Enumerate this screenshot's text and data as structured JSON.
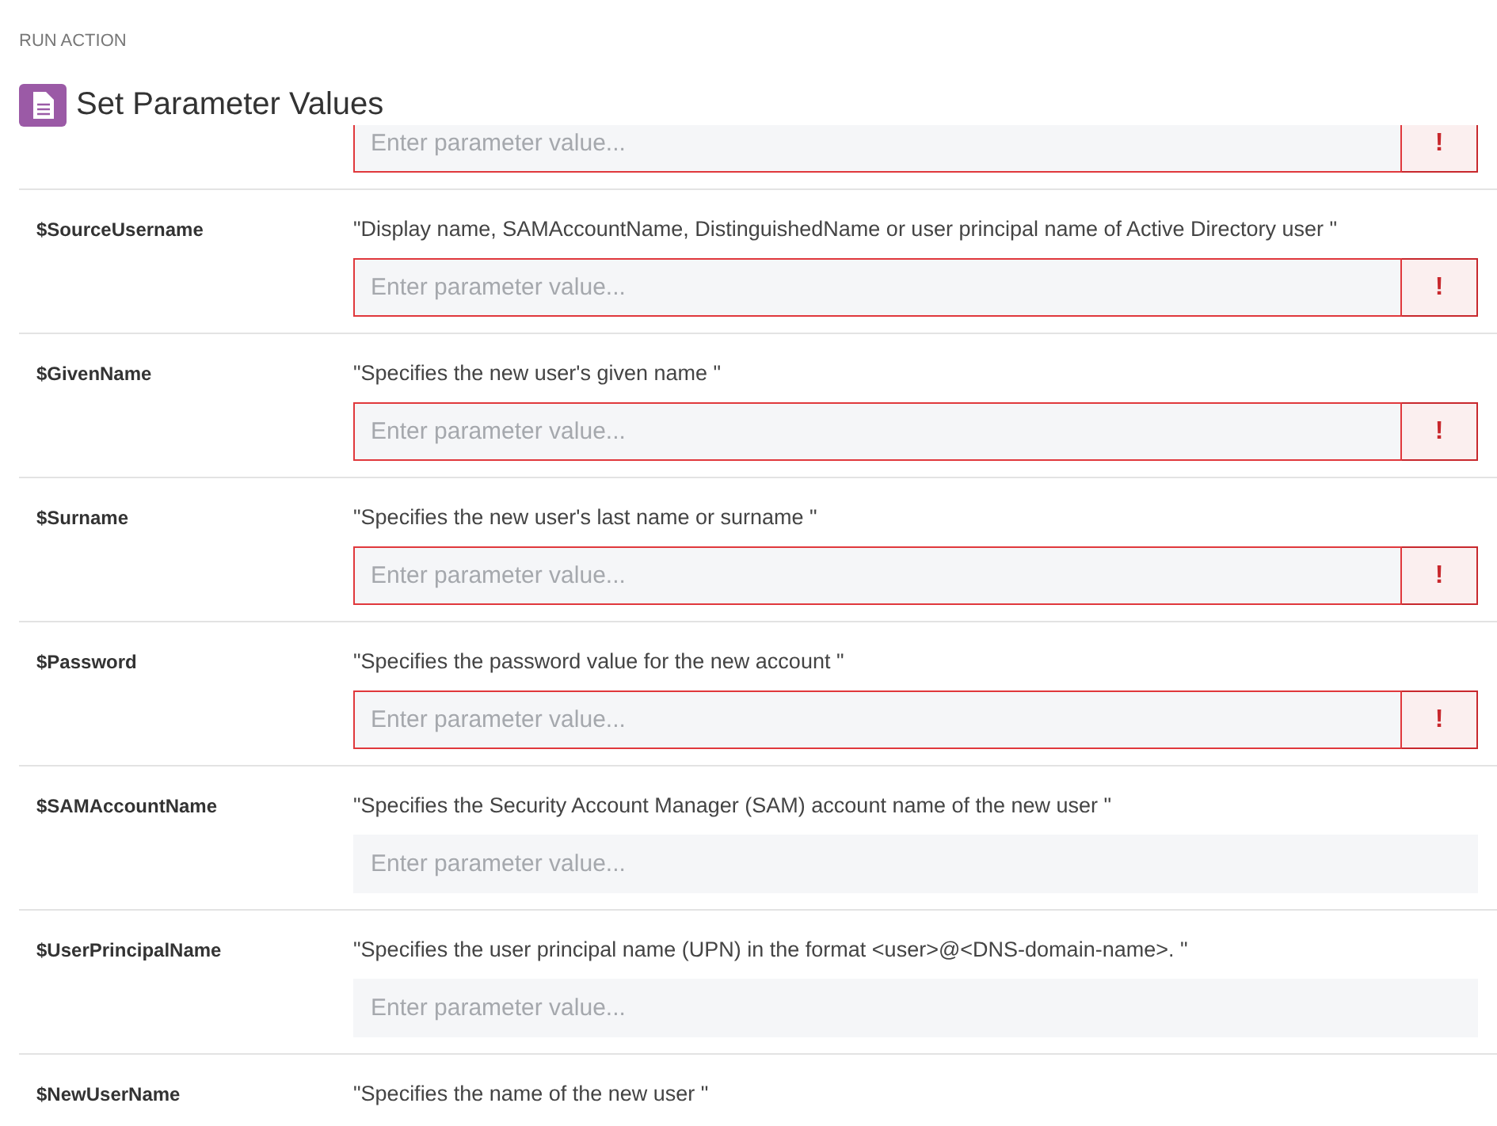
{
  "header": {
    "section": "RUN ACTION",
    "title": "Set Parameter Values"
  },
  "parameters": [
    {
      "field": {
        "placeholder": "Enter parameter value...",
        "required": true,
        "alert": "!"
      }
    },
    {
      "name": "$SourceUsername",
      "description": "\"Display name, SAMAccountName, DistinguishedName or user principal name of Active Directory user \"",
      "field": {
        "placeholder": "Enter parameter value...",
        "required": true,
        "alert": "!"
      }
    },
    {
      "name": "$GivenName",
      "description": "\"Specifies the new user's given name \"",
      "field": {
        "placeholder": "Enter parameter value...",
        "required": true,
        "alert": "!"
      }
    },
    {
      "name": "$Surname",
      "description": "\"Specifies the new user's last name or surname \"",
      "field": {
        "placeholder": "Enter parameter value...",
        "required": true,
        "alert": "!"
      }
    },
    {
      "name": "$Password",
      "description": "\"Specifies the password value for the new account \"",
      "field": {
        "placeholder": "Enter parameter value...",
        "required": true,
        "alert": "!"
      }
    },
    {
      "name": "$SAMAccountName",
      "description": "\"Specifies the Security Account Manager (SAM) account name of the new user \"",
      "field": {
        "placeholder": "Enter parameter value...",
        "required": false
      }
    },
    {
      "name": "$UserPrincipalName",
      "description": "\"Specifies the user principal name (UPN) in the format <user>@<DNS-domain-name>. \"",
      "field": {
        "placeholder": "Enter parameter value...",
        "required": false
      }
    },
    {
      "name": "$NewUserName",
      "description": "\"Specifies the name of the new user \""
    }
  ]
}
